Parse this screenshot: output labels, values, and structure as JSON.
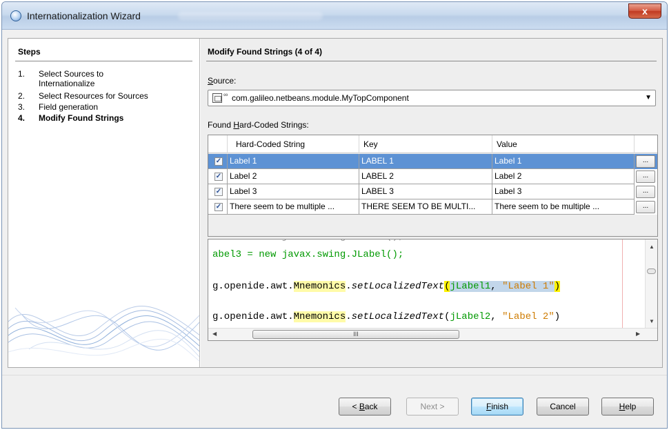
{
  "window": {
    "title": "Internationalization Wizard",
    "close_glyph": "x"
  },
  "steps": {
    "heading": "Steps",
    "items": [
      {
        "num": "1.",
        "label": "Select Sources to Internationalize"
      },
      {
        "num": "2.",
        "label": "Select Resources for Sources"
      },
      {
        "num": "3.",
        "label": "Field generation"
      },
      {
        "num": "4.",
        "label": "Modify Found Strings"
      }
    ]
  },
  "main": {
    "heading": "Modify Found Strings (4 of 4)",
    "source_label_mnemonic": "S",
    "source_label_rest": "ource:",
    "source_value": "com.galileo.netbeans.module.MyTopComponent",
    "found_label_pre": "Found ",
    "found_label_mnemonic": "H",
    "found_label_post": "ard-Coded Strings:"
  },
  "table": {
    "columns": [
      "Hard-Coded String",
      "Key",
      "Value"
    ],
    "rows": [
      {
        "checked": "✓",
        "string": "Label 1",
        "key": "LABEL 1",
        "value": "Label 1",
        "button": "...",
        "selected": true
      },
      {
        "checked": "✓",
        "string": "Label 2",
        "key": "LABEL 2",
        "value": "Label 2",
        "button": "..."
      },
      {
        "checked": "✓",
        "string": "Label 3",
        "key": "LABEL 3",
        "value": "Label 3",
        "button": "..."
      },
      {
        "checked": "✓",
        "string": "There seem to be multiple ...",
        "key": "THERE SEEM TO BE MULTI...",
        "value": "There seem to be multiple ...",
        "button": "..."
      }
    ]
  },
  "code": {
    "line1": "abel3 = new javax.swing.JLabel();",
    "line2_a": "g.openide.awt.",
    "line2_b": "Mnemonics",
    "line2_c": ".",
    "line2_d": "setLocalizedText",
    "line2_e": "(",
    "line2_f": "jLabel1",
    "line2_g": ", ",
    "line2_h": "\"Label 1\"",
    "line2_i": ")",
    "line3_a": "g.openide.awt.",
    "line3_b": "Mnemonics",
    "line3_c": ".",
    "line3_d": "setLocalizedText",
    "line3_e": "(",
    "line3_f": "jLabel2",
    "line3_g": ", ",
    "line3_h": "\"Label 2\"",
    "line3_i": ")",
    "scroll_grip": "III"
  },
  "buttons": {
    "back_prefix": "< ",
    "back_mnemonic": "B",
    "back_rest": "ack",
    "next": "Next >",
    "finish_mnemonic": "F",
    "finish_rest": "inish",
    "cancel": "Cancel",
    "help_mnemonic": "H",
    "help_rest": "elp"
  },
  "icons": {
    "window": "globe-icon",
    "source_file": "java-file-icon",
    "dropdown": "chevron-down-icon"
  }
}
